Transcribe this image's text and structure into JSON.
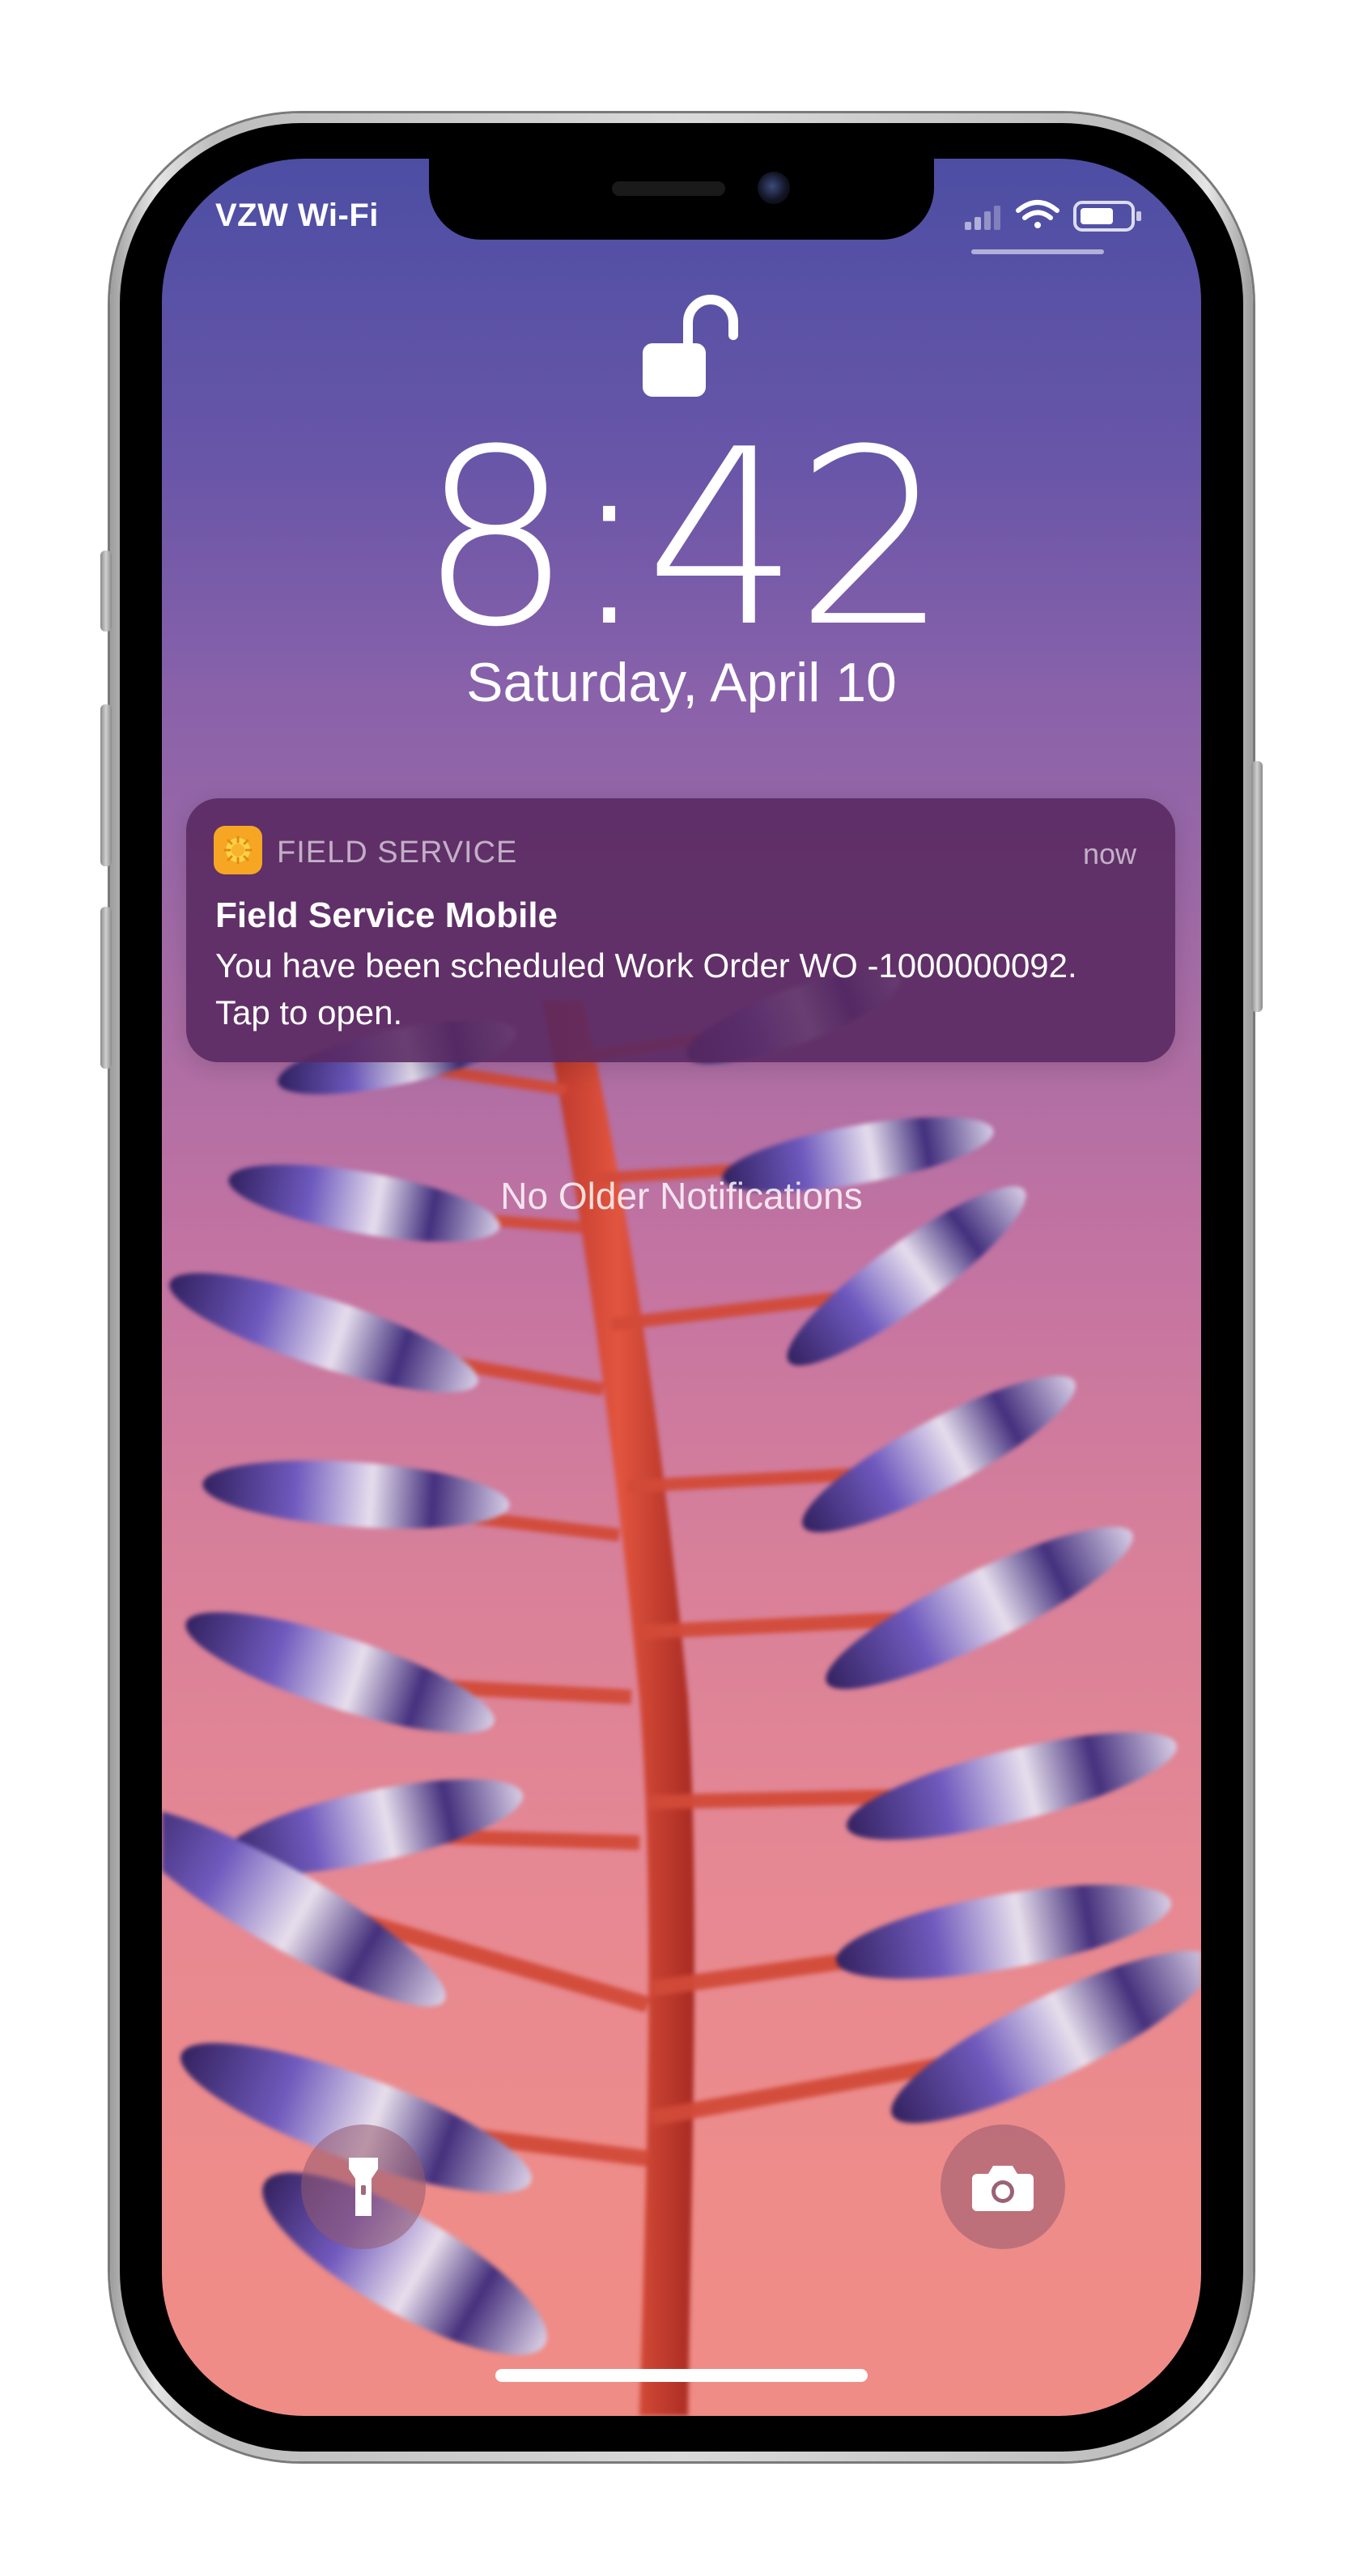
{
  "status_bar": {
    "carrier": "VZW Wi-Fi",
    "icons": [
      "cellular-signal-icon",
      "wifi-icon",
      "battery-icon"
    ]
  },
  "lock_screen": {
    "lock_state": "unlocked",
    "time": "8:42",
    "date": "Saturday, April 10",
    "no_older_notifications": "No Older Notifications"
  },
  "notification": {
    "app_name": "FIELD SERVICE",
    "time": "now",
    "title": "Field Service Mobile",
    "body": "You have been scheduled Work Order WO -1000000092. Tap to open.",
    "app_icon_color": "#f6a623"
  },
  "quick_actions": {
    "left": "flashlight-icon",
    "right": "camera-icon"
  },
  "colors": {
    "wallpaper_top": "#4c4ea4",
    "wallpaper_bottom": "#f08c86",
    "notification_bg": "#582860"
  }
}
